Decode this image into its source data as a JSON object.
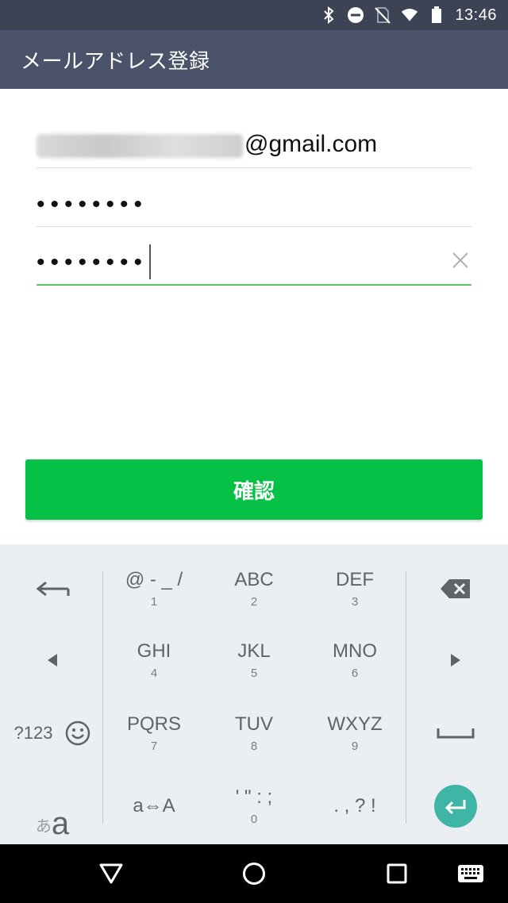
{
  "status_bar": {
    "time": "13:46"
  },
  "app_bar": {
    "title": "メールアドレス登録"
  },
  "form": {
    "email_domain": "@gmail.com",
    "password": "••••••••",
    "password_confirm": "••••••••"
  },
  "confirm_button": {
    "label": "確認"
  },
  "keyboard": {
    "keys": {
      "k1": {
        "main": "@ - _ /",
        "sub": "1"
      },
      "k2": {
        "main": "ABC",
        "sub": "2"
      },
      "k3": {
        "main": "DEF",
        "sub": "3"
      },
      "k4": {
        "main": "GHI",
        "sub": "4"
      },
      "k5": {
        "main": "JKL",
        "sub": "5"
      },
      "k6": {
        "main": "MNO",
        "sub": "6"
      },
      "k7": {
        "main": "PQRS",
        "sub": "7"
      },
      "k8": {
        "main": "TUV",
        "sub": "8"
      },
      "k9": {
        "main": "WXYZ",
        "sub": "9"
      },
      "kstar": {
        "main": "' \" : ;",
        "sub": "0"
      },
      "kpunct": {
        "main": ". , ? !"
      },
      "num_mode": "?123",
      "case_toggle": "a⇔A",
      "kana_small": "あ",
      "kana_big": "a"
    }
  },
  "colors": {
    "status_bar": "#3b4354",
    "app_bar": "#4a5369",
    "accent_green": "#06c145",
    "field_active": "#58c35f",
    "enter_key": "#3fb5a6"
  }
}
